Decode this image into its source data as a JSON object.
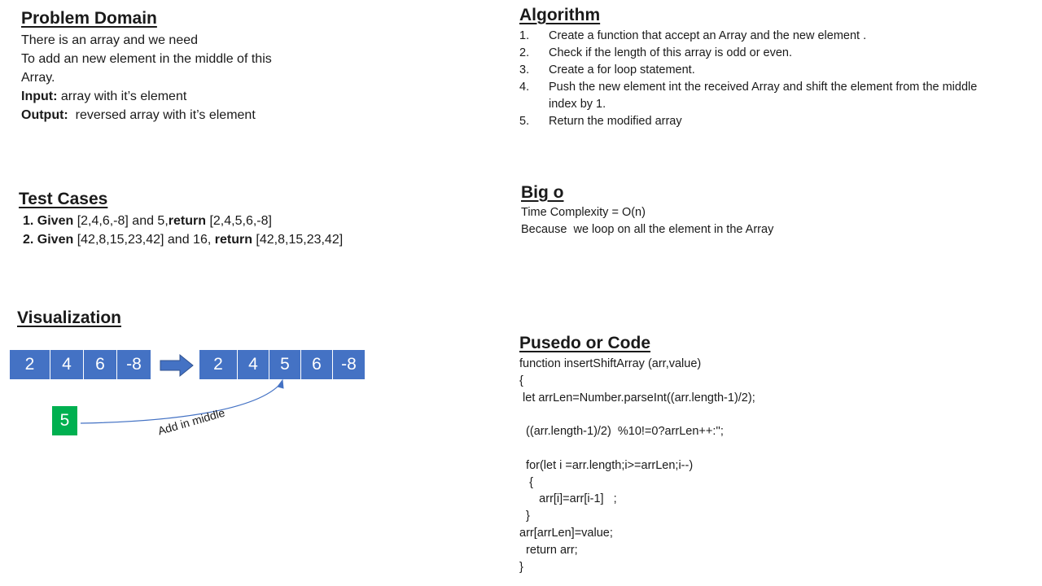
{
  "problem_domain": {
    "title": "Problem Domain",
    "lines": [
      "There is an array and we need",
      "To add an new element in the middle of this",
      "Array."
    ],
    "input_label": "Input:",
    "input_text": " array with it’s element",
    "output_label": "Output:",
    "output_text": "  reversed array with it’s element"
  },
  "algorithm": {
    "title": "Algorithm",
    "steps": [
      {
        "num": "1.",
        "text": "Create a function that accept an Array and the new element ."
      },
      {
        "num": "2.",
        "text": "Check if the length of this array is odd or even."
      },
      {
        "num": "3.",
        "text": "Create a for loop statement."
      },
      {
        "num": "4.",
        "text": "Push the new element int the received Array and shift the element from the middle index by 1."
      },
      {
        "num": "5.",
        "text": "Return the modified array"
      }
    ]
  },
  "test_cases": {
    "title": "Test Cases",
    "cases": [
      {
        "given_label": "1. Given",
        "given": " [2,4,6,-8] and 5,",
        "return_label": "return",
        "result": " [2,4,5,6,-8]"
      },
      {
        "given_label": "2. Given",
        "given": " [42,8,15,23,42] and 16, ",
        "return_label": "return",
        "result": " [42,8,15,23,42]"
      }
    ]
  },
  "big_o": {
    "title": "Big o",
    "lines": [
      "Time Complexity = O(n)",
      "Because  we loop on all the element in the Array"
    ]
  },
  "visualization": {
    "title": "Visualization",
    "input_array": [
      "2",
      "4",
      "6",
      "-8"
    ],
    "output_array": [
      "2",
      "4",
      "5",
      "6",
      "-8"
    ],
    "new_value": "5",
    "arrow_label": "Add in middle",
    "colors": {
      "cell": "#4472c4",
      "new_value": "#00b050"
    }
  },
  "code": {
    "title": "Pusedo or Code",
    "lines": [
      "function insertShiftArray (arr,value)",
      "{",
      " let arrLen=Number.parseInt((arr.length-1)/2);",
      "",
      "  ((arr.length-1)/2)  %10!=0?arrLen++:'';",
      "",
      "  for(let i =arr.length;i>=arrLen;i--)",
      "   {",
      "      arr[i]=arr[i-1]   ;",
      "  }",
      "arr[arrLen]=value;",
      "  return arr;",
      "}"
    ]
  }
}
